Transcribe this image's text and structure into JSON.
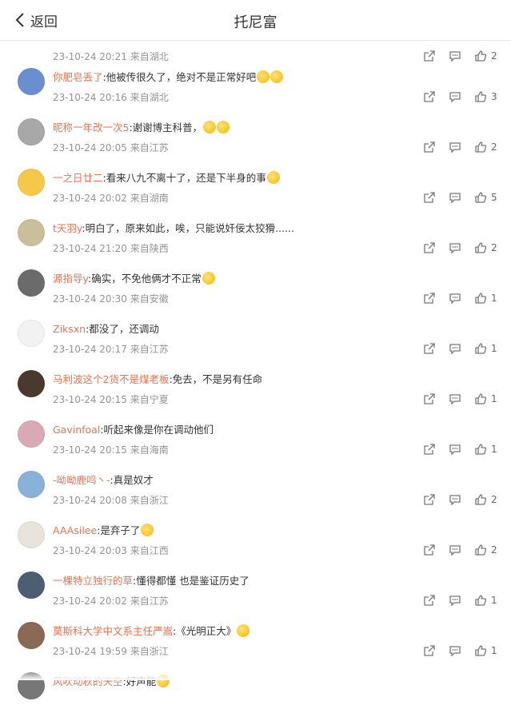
{
  "header": {
    "back_label": "返回",
    "title": "托尼富"
  },
  "colors": {
    "accent": "#ff8200",
    "username": "#eb7350",
    "meta": "#939393"
  },
  "comments": [
    {
      "user": "",
      "text": "",
      "time": "23-10-24 20:21",
      "location": "来自湖北",
      "likes": "2",
      "emojis": 0
    },
    {
      "user": "你肥皂丢了",
      "text": ":他被传很久了，绝对不是正常好吧",
      "time": "23-10-24 20:16",
      "location": "来自湖北",
      "likes": "3",
      "emojis": 2
    },
    {
      "user": "昵称一年改一次5",
      "text": ":谢谢博主科普，",
      "time": "23-10-24 20:05",
      "location": "来自江苏",
      "likes": "2",
      "emojis": 2
    },
    {
      "user": "一之日廿二",
      "text": ":看来八九不离十了，还是下半身的事",
      "time": "23-10-24 20:02",
      "location": "来自湖南",
      "likes": "5",
      "emojis": 1
    },
    {
      "user": "t天羽y",
      "text": ":明白了，原来如此，唉，只能说奸佞太狡猾......",
      "time": "23-10-24 21:20",
      "location": "来自陕西",
      "likes": "2",
      "emojis": 0
    },
    {
      "user": "源指导y",
      "text": ":确实，不免他俩才不正常",
      "time": "23-10-24 20:30",
      "location": "来自安徽",
      "likes": "1",
      "emojis": 1
    },
    {
      "user": "Ziksxn",
      "text": ":都没了，还调动",
      "time": "23-10-24 20:17",
      "location": "来自江苏",
      "likes": "1",
      "emojis": 0
    },
    {
      "user": "马利波这个2货不是煤老板",
      "text": ":免去，不是另有任命",
      "time": "23-10-24 20:15",
      "location": "来自宁夏",
      "likes": "1",
      "emojis": 0
    },
    {
      "user": "Gavinfoal",
      "text": ":听起来像是你在调动他们",
      "time": "23-10-24 20:15",
      "location": "来自海南",
      "likes": "1",
      "emojis": 0
    },
    {
      "user": "-呦呦鹿鸣丶-",
      "text": ":真是奴才",
      "time": "23-10-24 20:08",
      "location": "来自浙江",
      "likes": "2",
      "emojis": 0
    },
    {
      "user": "AAAsilee",
      "text": ":是弃子了",
      "time": "23-10-24 20:03",
      "location": "来自江西",
      "likes": "2",
      "emojis": 1
    },
    {
      "user": "一棵特立独行的草",
      "text": ":懂得都懂 也是鉴证历史了",
      "time": "23-10-24 20:02",
      "location": "来自江苏",
      "likes": "1",
      "emojis": 0
    },
    {
      "user": "莫斯科大学中文系主任严嵩",
      "text": ":《光明正大》",
      "time": "23-10-24 19:59",
      "location": "来自浙江",
      "likes": "1",
      "emojis": 1
    },
    {
      "user": "风吹动秋的天空",
      "text": ":好声能",
      "time": "",
      "location": "",
      "likes": "",
      "emojis": 1
    }
  ],
  "avatar_colors": [
    "#ffffff",
    "#6a8fd0",
    "#a8a8a8",
    "#f6c84a",
    "#c9bf9a",
    "#6b6b6b",
    "#f2f2f2",
    "#4a3a2e",
    "#d9a9b5",
    "#8ab2d8",
    "#e8e4dc",
    "#4b5e72",
    "#8a6a55",
    "#777777"
  ],
  "icons": {
    "share": "share-icon",
    "comment": "comment-icon",
    "like": "like-icon",
    "back": "chevron-left-icon"
  }
}
